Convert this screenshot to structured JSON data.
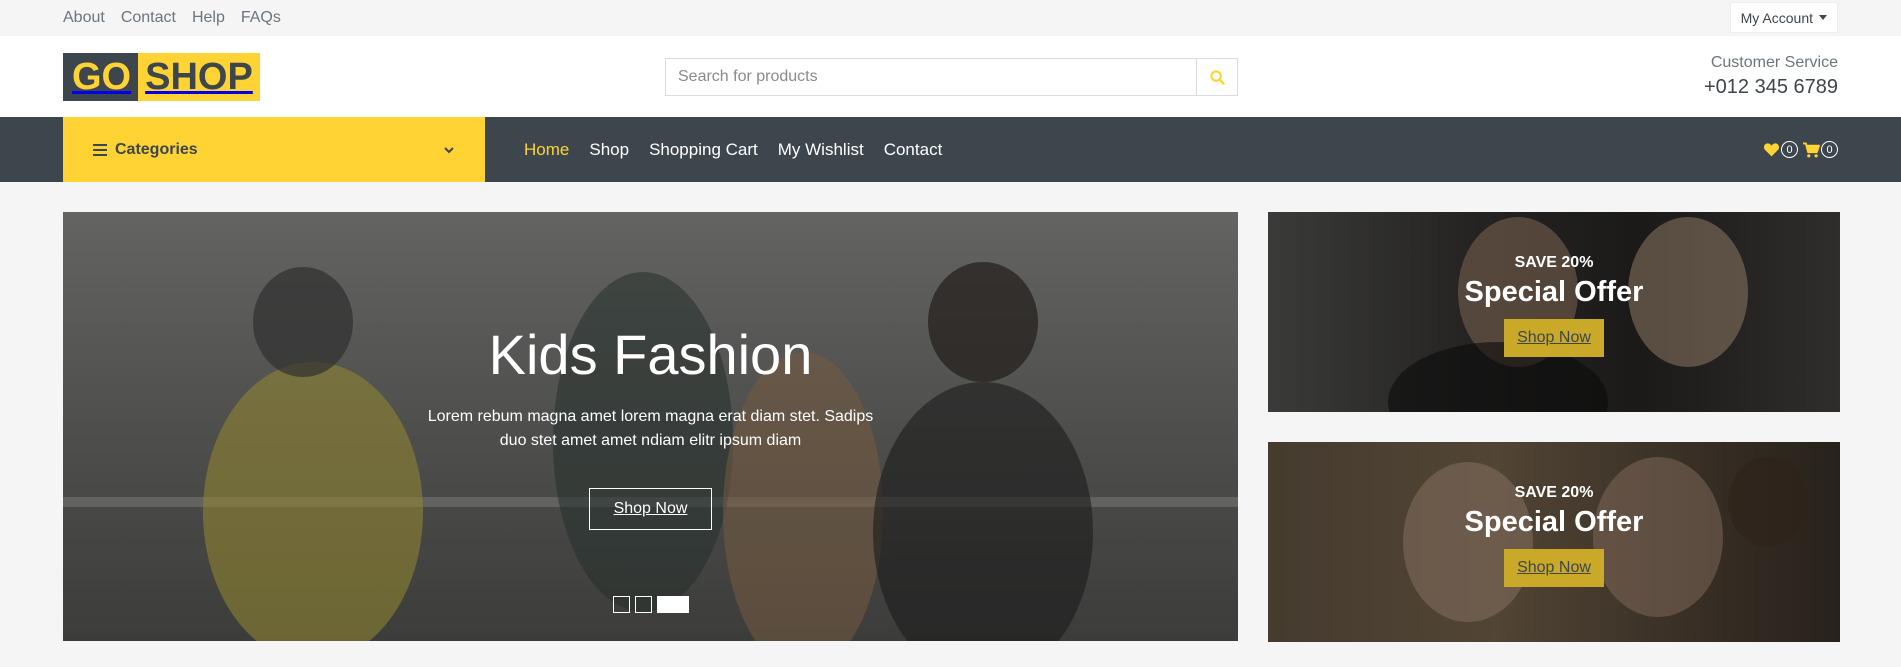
{
  "topbar": {
    "links": [
      "About",
      "Contact",
      "Help",
      "FAQs"
    ],
    "account_label": "My Account"
  },
  "header": {
    "logo_part1": "GO",
    "logo_part2": "SHOP",
    "search_placeholder": "Search for products",
    "customer_service_label": "Customer Service",
    "phone": "+012 345 6789"
  },
  "navbar": {
    "categories_label": "Categories",
    "menu": [
      "Home",
      "Shop",
      "Shopping Cart",
      "My Wishlist",
      "Contact"
    ],
    "active_menu": "Home",
    "wishlist_count": "0",
    "cart_count": "0"
  },
  "hero": {
    "title": "Kids Fashion",
    "text": "Lorem rebum magna amet lorem magna erat diam stet. Sadips duo stet amet amet ndiam elitr ipsum diam",
    "button": "Shop Now",
    "slide_count": 3,
    "active_slide": 3
  },
  "offers": [
    {
      "save": "SAVE 20%",
      "title": "Special Offer",
      "button": "Shop Now"
    },
    {
      "save": "SAVE 20%",
      "title": "Special Offer",
      "button": "Shop Now"
    }
  ],
  "colors": {
    "primary": "#ffd333",
    "dark": "#3d464d"
  },
  "icons": {
    "search": "search-icon",
    "heart": "heart-icon",
    "cart": "shopping-cart-icon",
    "menu": "bars-icon",
    "chevron": "chevron-down-icon"
  }
}
